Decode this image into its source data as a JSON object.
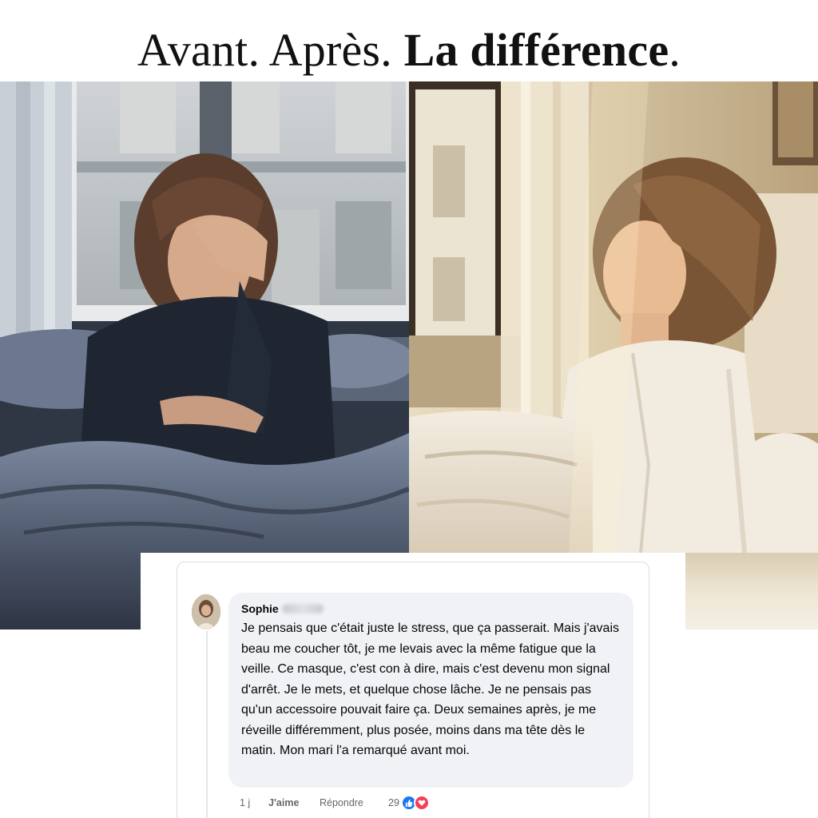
{
  "headline": {
    "part1": "Avant. Après.",
    "part2": "La différence",
    "period": "."
  },
  "photos": {
    "before": "woman-exhausted-in-bed",
    "after": "woman-relaxed-in-sunlight"
  },
  "comment": {
    "author": "Sophie",
    "text": "Je pensais que c'était juste le stress, que ça passerait. Mais j'avais beau me coucher tôt, je me levais avec la même fatigue que la veille. Ce masque, c'est con à dire, mais c'est devenu mon signal d'arrêt. Je le mets, et quelque chose lâche. Je ne pensais pas qu'un accessoire pouvait faire ça. Deux semaines après, je me réveille différemment, plus posée, moins dans ma tête dès le matin. Mon mari l'a remarqué avant moi.",
    "time": "1 j",
    "like_label": "J'aime",
    "reply_label": "Répondre",
    "reaction_count": "29",
    "reactions": [
      "like-icon",
      "love-icon"
    ]
  },
  "colors": {
    "like_blue": "#1877f2",
    "love_red": "#f33e58",
    "bubble_bg": "#f0f2f5"
  }
}
